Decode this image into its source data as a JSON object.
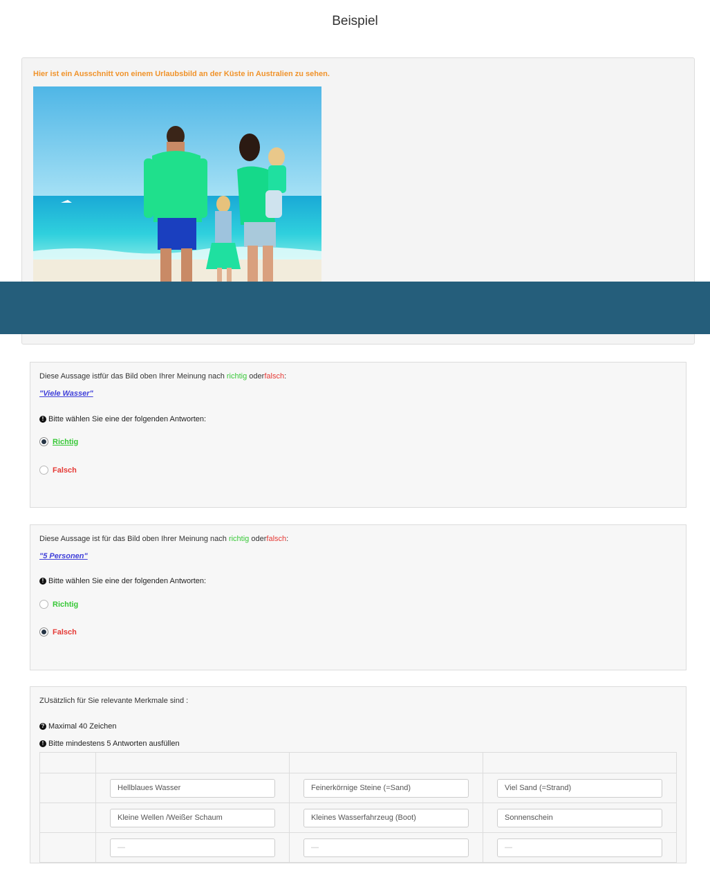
{
  "page_title": "Beispiel",
  "example": {
    "caption": "Hier ist ein Ausschnitt von einem Urlaubsbild an der Küste in Australien zu sehen."
  },
  "questions": [
    {
      "prompt_before": "Diese Aussage istfür das Bild oben Ihrer Meinung nach",
      "word_true": "richtig",
      "word_or": "oder",
      "word_false": "falsch",
      "colon": ":",
      "statement": "\"Viele Wasser\"",
      "hint": "Bitte wählen Sie eine der folgenden Antworten:",
      "options": [
        {
          "label": "Richtig",
          "selected": true
        },
        {
          "label": "Falsch",
          "selected": false
        }
      ]
    },
    {
      "prompt_before": "Diese Aussage ist für das Bild oben Ihrer Meinung nach",
      "word_true": "richtig",
      "word_or": "oder",
      "word_false": "falsch",
      "colon": ":",
      "statement": "\"5 Personen\"",
      "hint": "Bitte wählen Sie eine der folgenden Antworten:",
      "options": [
        {
          "label": "Richtig",
          "selected": false
        },
        {
          "label": "Falsch",
          "selected": true
        }
      ]
    }
  ],
  "features": {
    "title": "ZUsätzlich für Sie relevante Merkmale sind :",
    "hint_max": "Maximal 40 Zeichen",
    "hint_min": "Bitte mindestens 5 Antworten ausfüllen",
    "rows": [
      [
        "Hellblaues Wasser",
        "Feinerkörnige Steine (=Sand)",
        "Viel Sand (=Strand)"
      ],
      [
        "Kleine Wellen /Weißer Schaum",
        "Kleines Wasserfahrzeug (Boot)",
        "Sonnenschein"
      ],
      [
        "—",
        "—",
        "—"
      ]
    ]
  },
  "colors": {
    "banner": "#255e7b",
    "caption": "#f0932b",
    "true_green": "#37c837",
    "false_red": "#e53935",
    "link_blue": "#3f3fd9"
  },
  "icons": [
    "exclamation-circle-icon",
    "question-circle-icon"
  ]
}
